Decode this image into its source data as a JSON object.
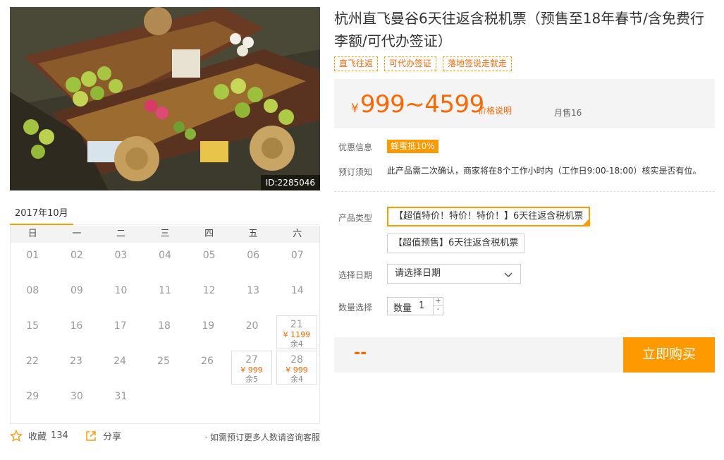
{
  "photo": {
    "id_label": "ID:2285046"
  },
  "calendar": {
    "month_label": "2017年10月",
    "weekdays": [
      "日",
      "一",
      "二",
      "三",
      "四",
      "五",
      "六"
    ],
    "weeks": [
      [
        {
          "d": "01"
        },
        {
          "d": "02"
        },
        {
          "d": "03"
        },
        {
          "d": "04"
        },
        {
          "d": "05"
        },
        {
          "d": "06"
        },
        {
          "d": "07"
        }
      ],
      [
        {
          "d": "08"
        },
        {
          "d": "09"
        },
        {
          "d": "10"
        },
        {
          "d": "11"
        },
        {
          "d": "12"
        },
        {
          "d": "13"
        },
        {
          "d": "14"
        }
      ],
      [
        {
          "d": "15"
        },
        {
          "d": "16"
        },
        {
          "d": "17"
        },
        {
          "d": "18"
        },
        {
          "d": "19"
        },
        {
          "d": "20"
        },
        {
          "d": "21",
          "price": "¥ 1199",
          "stock": "余4"
        }
      ],
      [
        {
          "d": "22"
        },
        {
          "d": "23"
        },
        {
          "d": "24"
        },
        {
          "d": "25"
        },
        {
          "d": "26"
        },
        {
          "d": "27",
          "price": "¥ 999",
          "stock": "余5"
        },
        {
          "d": "28",
          "price": "¥ 999",
          "stock": "余4"
        }
      ],
      [
        {
          "d": "29"
        },
        {
          "d": "30"
        },
        {
          "d": "31"
        },
        {
          "d": ""
        },
        {
          "d": ""
        },
        {
          "d": ""
        },
        {
          "d": ""
        }
      ]
    ]
  },
  "footer": {
    "favorite_label": "收藏",
    "favorite_count": "134",
    "share_label": "分享",
    "tip": "· 如需预订更多人数请咨询客服"
  },
  "product": {
    "title": "杭州直飞曼谷6天往返含税机票（预售至18年春节/含免费行李额/可代办签证）",
    "tags": [
      "直飞往返",
      "可代办签证",
      "落地签说走就走"
    ],
    "price_currency": "¥",
    "price_range": "999~4599",
    "price_note": "价格说明",
    "monthly_sales": "月售16"
  },
  "info": {
    "promo_label": "优惠信息",
    "promo_badge": "蜂蜜抵10%",
    "notice_label": "预订须知",
    "notice_text": "此产品需二次确认，商家将在8个工作小时内（工作日9:00-18:00）核实是否有位。"
  },
  "options": {
    "type_label": "产品类型",
    "types": [
      "【超值特价！特价！特价！】6天往返含税机票",
      "【超值预售】6天往返含税机票"
    ],
    "date_label": "选择日期",
    "date_placeholder": "请选择日期",
    "qty_label": "数量选择",
    "qty_inner_label": "数量",
    "qty_value": "1",
    "qty_plus": "+",
    "qty_minus": "-"
  },
  "buy": {
    "total": "--",
    "button_label": "立即购买"
  },
  "colors": {
    "accent": "#ff9900",
    "price": "#ff6600"
  }
}
